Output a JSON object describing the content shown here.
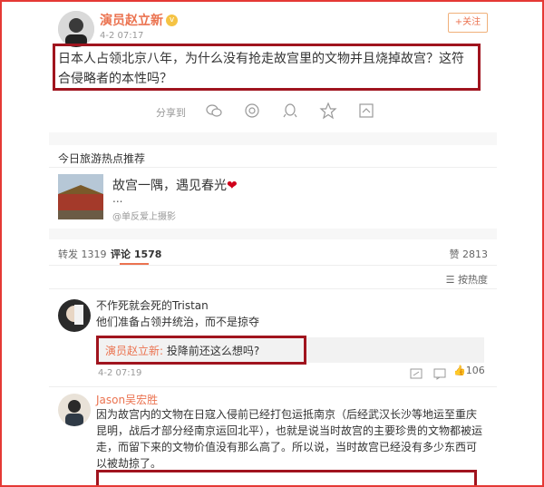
{
  "post": {
    "author": "演员赵立新",
    "timestamp": "4-2 07:17",
    "follow_label": "+关注",
    "body": "日本人占领北京八年，为什么没有抢走故宫里的文物并且烧掉故宫？这符合侵略者的本性吗？",
    "share_label": "分享到"
  },
  "recommend": {
    "section_title": "今日旅游热点推荐",
    "headline": "故宫一隅，遇见春光",
    "ellipsis": "...",
    "source": "@单反爱上摄影"
  },
  "tabs": {
    "repost": "转发 1319",
    "comments": "评论 1578",
    "likes": "赞 2813",
    "sort": "按热度"
  },
  "comments": [
    {
      "author": "不作死就会死的Tristan",
      "text": "他们准备占领并统治，而不是掠夺",
      "reply_author": "演员赵立新:",
      "reply_text": " 投降前还这么想吗?",
      "timestamp": "4-2 07:19",
      "likes": "106"
    },
    {
      "author": "Jason吴宏胜",
      "text": "因为故宫内的文物在日寇入侵前已经打包运抵南京（后经武汉长沙等地运至重庆昆明，战后才部分经南京运回北平），也就是说当时故宫的主要珍贵的文物都被运走，而留下来的文物价值没有那么高了。所以说，当时故宫已经没有多少东西可以被劫掠了。"
    }
  ],
  "colors": {
    "highlight_border": "#a0141e",
    "frame_border": "#e53935",
    "name_orange": "#eb7350"
  }
}
